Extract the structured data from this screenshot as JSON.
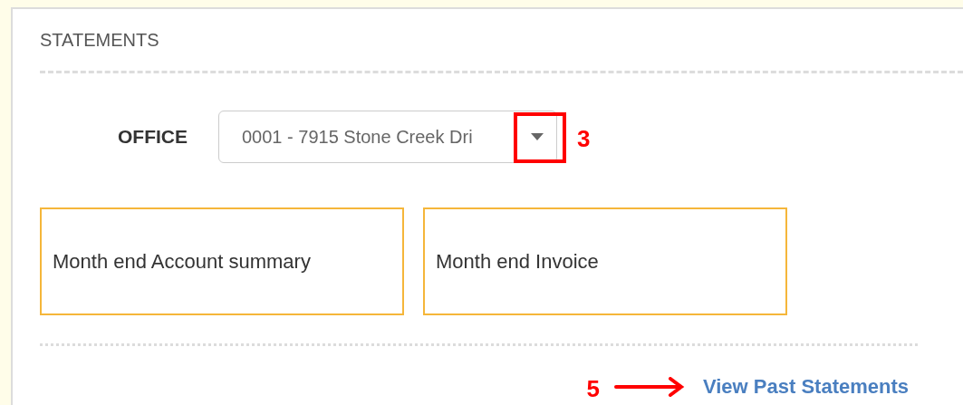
{
  "panel": {
    "title": "STATEMENTS"
  },
  "office": {
    "label": "OFFICE",
    "value": "0001 - 7915 Stone Creek Dri",
    "annotation": "3"
  },
  "cards": [
    {
      "label": "Month end Account summary"
    },
    {
      "label": "Month end Invoice"
    }
  ],
  "link": {
    "label": "View Past Statements",
    "annotation": "5"
  }
}
